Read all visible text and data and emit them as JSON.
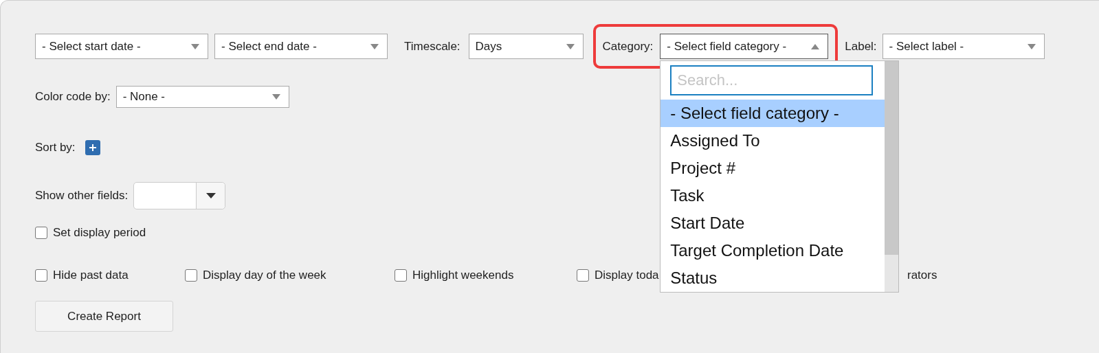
{
  "date_selects": [
    {
      "value": "- Select start date -"
    },
    {
      "value": "- Select end date -"
    }
  ],
  "timescale": {
    "label": "Timescale:",
    "value": "Days"
  },
  "category": {
    "label": "Category:",
    "value": "- Select field category -",
    "expanded": true,
    "highlighted": true
  },
  "label_select": {
    "label": "Label:",
    "value": "- Select label -"
  },
  "category_dropdown": {
    "search": {
      "placeholder": "Search..."
    },
    "options": [
      {
        "label": "- Select field category -",
        "selected": true
      },
      {
        "label": "Assigned To",
        "selected": false
      },
      {
        "label": "Project #",
        "selected": false
      },
      {
        "label": "Task",
        "selected": false
      },
      {
        "label": "Start Date",
        "selected": false
      },
      {
        "label": "Target Completion Date",
        "selected": false
      },
      {
        "label": "Status",
        "selected": false
      }
    ]
  },
  "color_code": {
    "label": "Color code by:",
    "value": "- None -"
  },
  "sort_by": {
    "label": "Sort by:"
  },
  "other_fields": {
    "label": "Show other fields:"
  },
  "display_period": {
    "label": "Set display period",
    "checked": false
  },
  "options": [
    {
      "label": "Hide past data",
      "checked": false
    },
    {
      "label": "Display day of the week",
      "checked": false
    },
    {
      "label": "Highlight weekends",
      "checked": false
    },
    {
      "label": "Display toda",
      "checked": false
    }
  ],
  "option_fragment": "rators",
  "button": "Create Report"
}
